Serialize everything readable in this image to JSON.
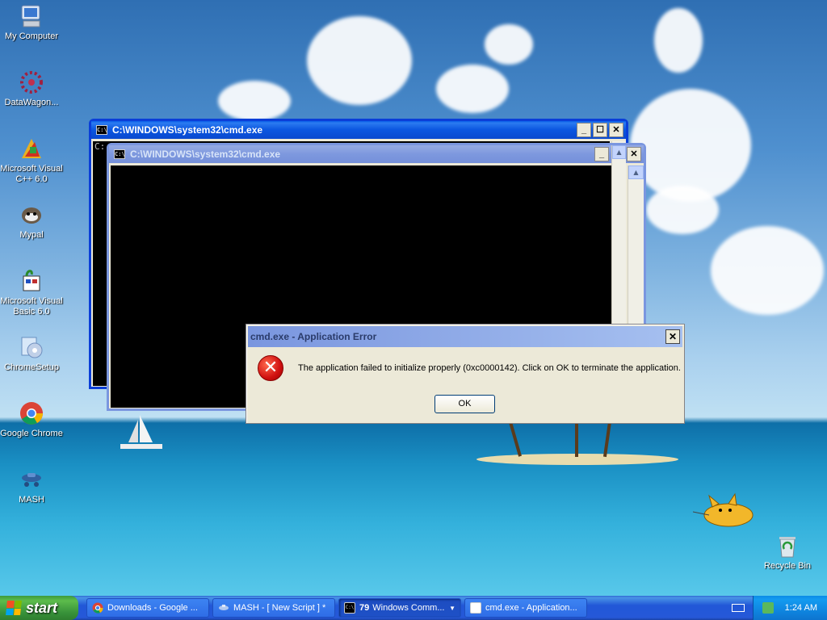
{
  "desktop": {
    "icons": [
      {
        "label": "My Computer",
        "icon": "my-computer-icon"
      },
      {
        "label": "DataWagon...",
        "icon": "datawagon-icon"
      },
      {
        "label": "Microsoft Visual C++ 6.0",
        "icon": "visual-cpp-icon"
      },
      {
        "label": "Mypal",
        "icon": "mypal-icon"
      },
      {
        "label": "Microsoft Visual Basic 6.0",
        "icon": "visual-basic-icon"
      },
      {
        "label": "ChromeSetup",
        "icon": "chrome-setup-icon"
      },
      {
        "label": "Google Chrome",
        "icon": "chrome-icon"
      },
      {
        "label": "MASH",
        "icon": "mash-icon"
      },
      {
        "label": "Recycle Bin",
        "icon": "recycle-bin-icon"
      }
    ]
  },
  "windows": {
    "cmd_back": {
      "title": "C:\\WINDOWS\\system32\\cmd.exe",
      "console_text": "C:"
    },
    "cmd_front": {
      "title": "C:\\WINDOWS\\system32\\cmd.exe"
    }
  },
  "dialog": {
    "title": "cmd.exe - Application Error",
    "message": "The application failed to initialize properly (0xc0000142). Click on OK to terminate the application.",
    "ok_label": "OK"
  },
  "taskbar": {
    "start_label": "start",
    "tasks": [
      {
        "label": "Downloads - Google ...",
        "icon": "chrome-icon"
      },
      {
        "label": "MASH - [ New Script ] *",
        "icon": "mash-icon"
      },
      {
        "count": "79",
        "label": "Windows Comm...",
        "icon": "cmd-icon",
        "active": true
      },
      {
        "label": "cmd.exe - Application...",
        "icon": "window-icon"
      }
    ],
    "clock": "1:24 AM"
  },
  "colors": {
    "title_active": "#0a5ee8",
    "error_red": "#d01010",
    "taskbar_blue": "#2658d8",
    "start_green": "#38923a"
  }
}
